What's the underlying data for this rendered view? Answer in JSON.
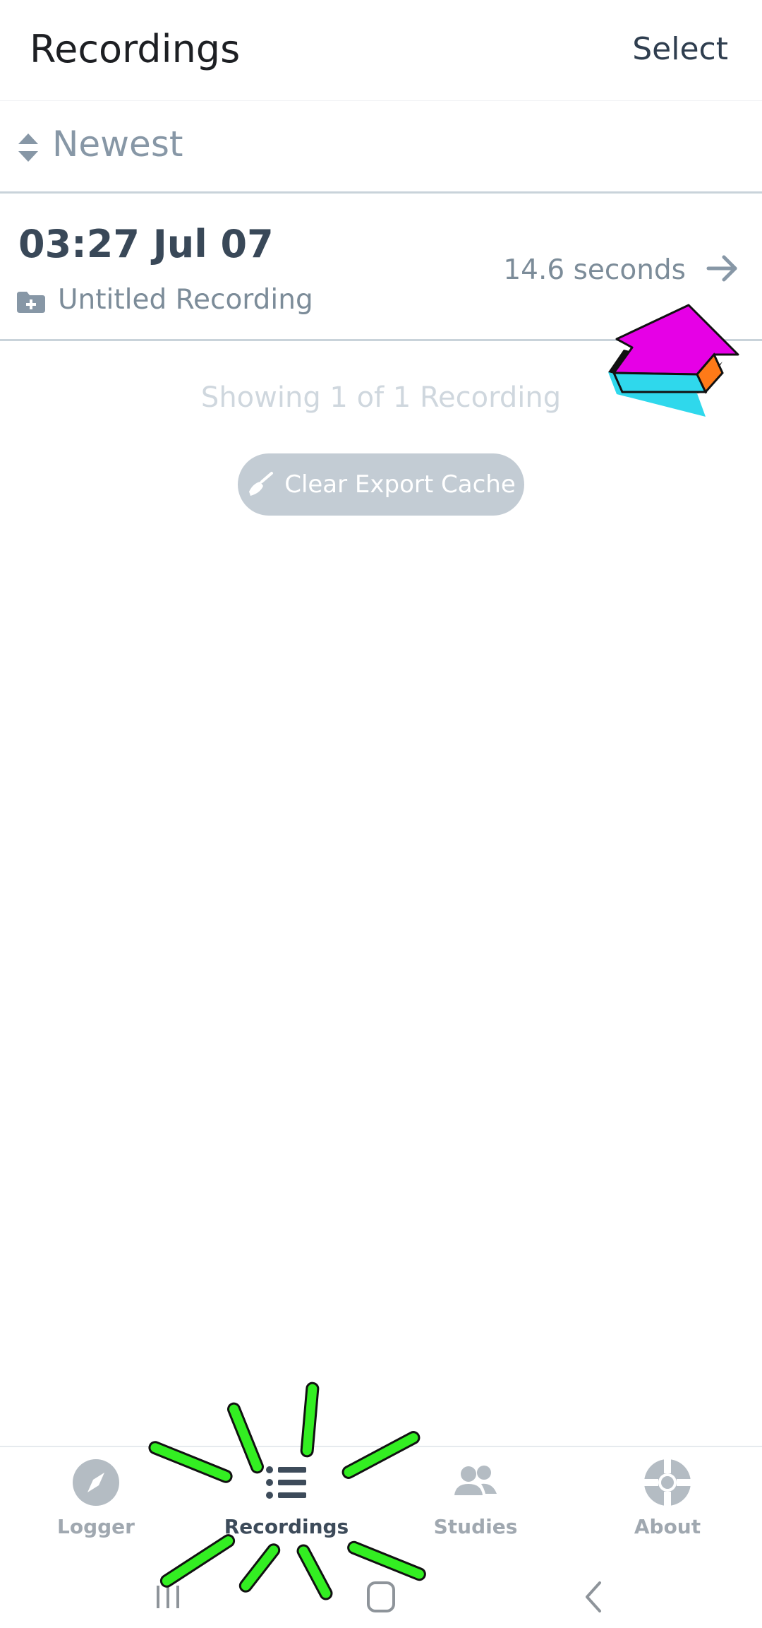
{
  "header": {
    "title": "Recordings",
    "select_label": "Select"
  },
  "sort": {
    "label": "Newest",
    "icon": "sort-updown-icon"
  },
  "recordings": [
    {
      "time": "03:27 Jul 07",
      "name": "Untitled Recording",
      "duration": "14.6 seconds",
      "icon": "folder-plus-icon"
    }
  ],
  "summary": "Showing 1 of 1 Recording",
  "clear_button": {
    "label": "Clear Export Cache",
    "icon": "broom-icon"
  },
  "tabs": [
    {
      "label": "Logger",
      "icon": "compass-icon",
      "active": false
    },
    {
      "label": "Recordings",
      "icon": "list-icon",
      "active": true
    },
    {
      "label": "Studies",
      "icon": "people-icon",
      "active": false
    },
    {
      "label": "About",
      "icon": "lifebuoy-icon",
      "active": false
    }
  ],
  "colors": {
    "accent": "#3d4b5a",
    "inactive": "#a0a8b0",
    "divider": "#c9d3da",
    "overlay_arrow": "#e600e6",
    "overlay_burst": "#33ee22"
  }
}
